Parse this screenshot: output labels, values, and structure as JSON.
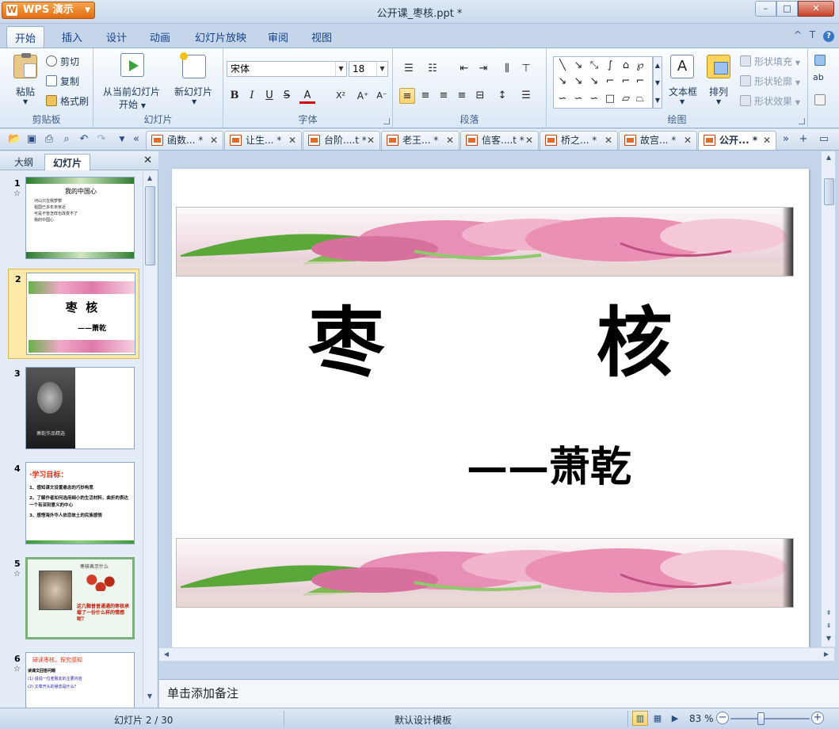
{
  "app": {
    "name": "WPS 演示",
    "logo": "W",
    "title": "公开课_枣核.ppt *"
  },
  "window": {
    "minimize": "–",
    "maximize": "□",
    "close": "✕"
  },
  "menu": {
    "tabs": [
      "开始",
      "插入",
      "设计",
      "动画",
      "幻灯片放映",
      "审阅",
      "视图"
    ],
    "active": "开始"
  },
  "right_icons": {
    "up": "^",
    "skin": "T",
    "help": "?"
  },
  "ribbon": {
    "clipboard": {
      "paste": "粘贴",
      "cut": "剪切",
      "copy": "复制",
      "format_painter": "格式刷",
      "label": "剪贴板"
    },
    "slides": {
      "from_current": "从当前幻灯片",
      "from_current2": "开始",
      "new_slide": "新幻灯片",
      "label": "幻灯片"
    },
    "font": {
      "name": "宋体",
      "size": "18",
      "bold": "B",
      "italic": "I",
      "underline": "U",
      "strike": "S",
      "color": "A",
      "superscript": "X²",
      "grow": "A⁺",
      "shrink": "A⁻",
      "label": "字体"
    },
    "paragraph": {
      "label": "段落"
    },
    "drawing": {
      "textbox": "文本框",
      "arrange": "排列",
      "fill": "形状填充",
      "outline": "形状轮廓",
      "effects": "形状效果",
      "label": "绘图"
    }
  },
  "doc_tabs": [
    "函数... *",
    "让生... *",
    "台阶....t *",
    "老王... *",
    "信客....t *",
    "桥之... *",
    "故宫... *",
    "公开... *"
  ],
  "active_doc_tab": 7,
  "left_panel": {
    "tabs": [
      "大纲",
      "幻灯片"
    ],
    "active": "幻灯片"
  },
  "thumbnails": [
    {
      "num": "1",
      "star": true,
      "title": "我的中国心",
      "lines": [
        "河山只在我梦萦",
        "祖国已多年未亲近",
        "可是不管怎样也改变不了",
        "我的中国心"
      ]
    },
    {
      "num": "2",
      "star": false,
      "title": "枣  核",
      "subtitle": "——萧乾"
    },
    {
      "num": "3",
      "star": false,
      "caption": "萧乾作品精选"
    },
    {
      "num": "4",
      "star": false,
      "title": "·学习目标：",
      "lines": [
        "1、感知课文设置悬念的巧妙构思",
        "2、了解作者如何选用细小的生活材料，曲折的表达一个有深刻意义的中心",
        "3、感悟海外华人依恋故土的民族感情"
      ]
    },
    {
      "num": "5",
      "star": true,
      "title": "枣核表示什么",
      "caption": "这几颗普普通通的枣核承载了一份什么样的情感呢？"
    },
    {
      "num": "6",
      "star": true,
      "title": "研读枣核，探究感知",
      "lines": [
        "读课文回答问题",
        "(1) 说说一位老朋友的主要内容",
        "(2) 文章开头的悬念是什么？"
      ]
    }
  ],
  "slide": {
    "title": "枣        核",
    "author": "——萧乾"
  },
  "notes_placeholder": "单击添加备注",
  "status": {
    "slide_info": "幻灯片 2 / 30",
    "template": "默认设计模板",
    "zoom": "83 %",
    "zoom_level": 0.83
  },
  "colors": {
    "accent": "#e36d10",
    "ribbon_bg": "#dce8f5",
    "selection": "#fde9a9"
  }
}
